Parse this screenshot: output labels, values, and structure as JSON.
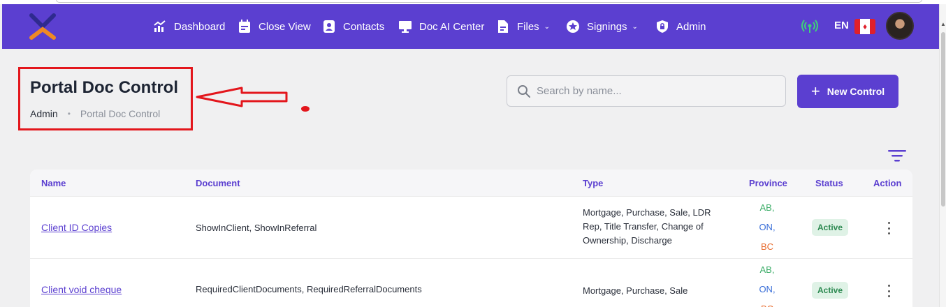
{
  "nav": {
    "items": [
      {
        "label": "Dashboard",
        "icon": "chart-icon"
      },
      {
        "label": "Close View",
        "icon": "calendar-icon"
      },
      {
        "label": "Contacts",
        "icon": "contact-card-icon"
      },
      {
        "label": "Doc AI Center",
        "icon": "monitor-icon"
      },
      {
        "label": "Files",
        "icon": "file-icon",
        "dropdown": true
      },
      {
        "label": "Signings",
        "icon": "star-badge-icon",
        "dropdown": true
      },
      {
        "label": "Admin",
        "icon": "lock-shield-icon"
      }
    ],
    "language": "EN",
    "chevron": "⌄"
  },
  "header": {
    "title": "Portal Doc Control",
    "breadcrumb": [
      "Admin",
      "Portal Doc Control"
    ],
    "breadcrumb_sep": "•"
  },
  "search": {
    "placeholder": "Search by name..."
  },
  "actions": {
    "new_control": "New Control",
    "plus": "+"
  },
  "table": {
    "columns": [
      "Name",
      "Document",
      "Type",
      "Province",
      "Status",
      "Action"
    ],
    "rows": [
      {
        "name": "Client ID Copies",
        "document": "ShowInClient, ShowInReferral",
        "type": "Mortgage, Purchase, Sale, LDR Rep, Title Transfer, Change of Ownership, Discharge",
        "provinces": [
          "AB,",
          "ON,",
          "BC"
        ],
        "status": "Active"
      },
      {
        "name": "Client void cheque",
        "document": "RequiredClientDocuments, RequiredReferralDocuments",
        "type": "Mortgage, Purchase, Sale",
        "provinces": [
          "AB,",
          "ON,",
          "BC"
        ],
        "status": "Active"
      }
    ]
  },
  "colors": {
    "brand": "#5b3fd0",
    "annotation": "#e3161c",
    "ab": "#3fae6a",
    "on": "#3a6fd8",
    "bc": "#e86a2c",
    "active_bg": "#dff2e6",
    "active_text": "#2e8a52"
  }
}
